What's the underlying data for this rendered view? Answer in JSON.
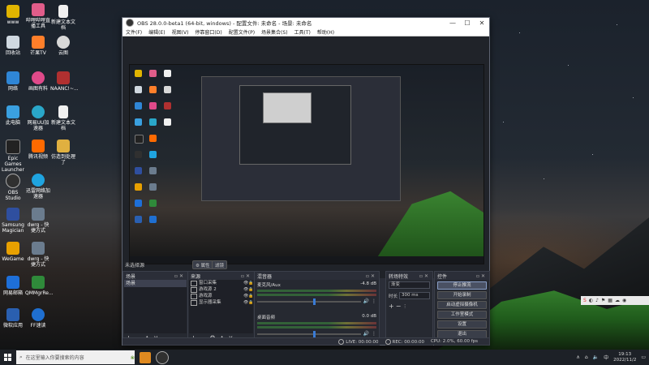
{
  "desktop": {
    "icons": [
      {
        "label": "www",
        "color": "#e0b400"
      },
      {
        "label": "回收站",
        "color": "#cfd8e0"
      },
      {
        "label": "网络",
        "color": "#2f86d6"
      },
      {
        "label": "此电脑",
        "color": "#3aa0e0"
      },
      {
        "label": "Epic Games Launcher",
        "color": "#222222"
      },
      {
        "label": "OBS Studio",
        "color": "#303030"
      },
      {
        "label": "Samsung Magician",
        "color": "#2f4f9f"
      },
      {
        "label": "WeGame",
        "color": "#e8a000"
      },
      {
        "label": "网易邮箱",
        "color": "#1e6fd8"
      },
      {
        "label": "微软应用",
        "color": "#2a5fb0"
      },
      {
        "label": "哔哩哔哩直播工具",
        "color": "#e05d8a"
      },
      {
        "label": "芒果TV",
        "color": "#ff7f2a"
      },
      {
        "label": "画图有料",
        "color": "#e04a8a"
      },
      {
        "label": "网易UU加速器",
        "color": "#2aa7c9"
      },
      {
        "label": "腾讯视频",
        "color": "#ff6a00"
      },
      {
        "label": "迅雷网络加速器",
        "color": "#1fa4e0"
      },
      {
        "label": "dwrg - 快捷方式",
        "color": "#6b7c8e"
      },
      {
        "label": "dwrg - 快捷方式",
        "color": "#6b7c8e"
      },
      {
        "label": "QMMgrRe...",
        "color": "#2f8a3a"
      },
      {
        "label": "FF速读",
        "color": "#1f6fd0"
      },
      {
        "label": "新建文本文档",
        "color": "#f0f0f0"
      },
      {
        "label": "云图",
        "color": "#d8d8d8"
      },
      {
        "label": "NAANC!~...",
        "color": "#b03030"
      },
      {
        "label": "新建文本文档",
        "color": "#f0f0f0"
      },
      {
        "label": "仿造到处理了",
        "color": "#e0b040"
      }
    ]
  },
  "window": {
    "title": "OBS 28.0.0-beta1 (64-bit, windows) - 配置文件: 未命名 - 场景: 未命名",
    "controls": {
      "minimize": "—",
      "maximize": "☐",
      "close": "✕"
    }
  },
  "menu": [
    "文件(F)",
    "编辑(E)",
    "视图(V)",
    "停靠窗口(D)",
    "配置文件(P)",
    "场景集合(S)",
    "工具(T)",
    "帮助(H)"
  ],
  "preview": {
    "source_label": "未选择源",
    "props_label": "⚙ 属性",
    "filters_label": "滤镜"
  },
  "docks": {
    "scenes": {
      "title": "场景",
      "items": [
        "场景"
      ]
    },
    "sources": {
      "title": "来源",
      "items": [
        "窗口采集",
        "游戏源 2",
        "游戏源",
        "显示器采集"
      ]
    },
    "mixer": {
      "title": "混音器",
      "channels": [
        {
          "name": "麦克风/Aux",
          "db": "-4.8 dB",
          "level": 0.55
        },
        {
          "name": "桌面音频",
          "db": "0.0 dB",
          "level": 0.55
        }
      ]
    },
    "transitions": {
      "title": "转场特效",
      "type": "渐变",
      "duration_label": "时长",
      "duration": "300 ms"
    },
    "controls": {
      "title": "控件",
      "buttons": [
        "停止推流",
        "开始录制",
        "启动虚拟摄像机",
        "工作室模式",
        "设置",
        "退出"
      ]
    }
  },
  "status": {
    "live": "LIVE: 00:00:00",
    "rec": "REC: 00:00:00",
    "cpu": "CPU: 2.0%, 60.00 fps"
  },
  "taskbar": {
    "search_placeholder": "在这里输入你要搜索的内容",
    "time": "19:13",
    "date": "2022/11/2"
  }
}
